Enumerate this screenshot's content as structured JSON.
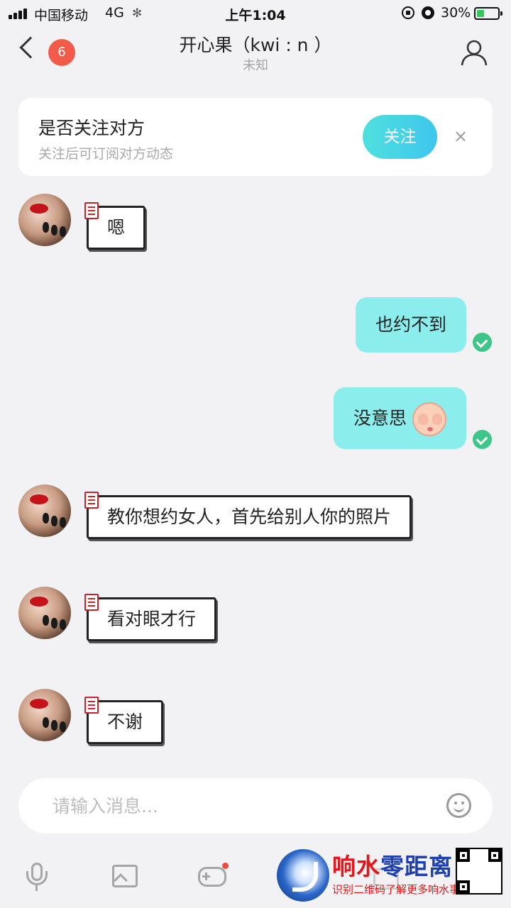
{
  "status_bar": {
    "carrier": "中国移动",
    "network": "4G",
    "time": "上午1:04",
    "battery_percent": "30%"
  },
  "header": {
    "unread_count": "6",
    "title": "开心果（kwi : n ）",
    "subtitle": "未知"
  },
  "follow_card": {
    "title": "是否关注对方",
    "description": "关注后可订阅对方动态",
    "button_label": "关注",
    "close_label": "×"
  },
  "messages": [
    {
      "direction": "incoming",
      "text": "嗯"
    },
    {
      "direction": "outgoing",
      "text": "也约不到",
      "read": true
    },
    {
      "direction": "outgoing",
      "text": "没意思",
      "emoji": "covering-eyes-face",
      "read": true
    },
    {
      "direction": "incoming",
      "text": "教你想约女人，首先给别人你的照片"
    },
    {
      "direction": "incoming",
      "text": "看对眼才行"
    },
    {
      "direction": "incoming",
      "text": "不谢"
    }
  ],
  "input": {
    "placeholder": "请输入消息..."
  },
  "toolbar": {
    "icons": [
      "mic-icon",
      "image-icon",
      "game-controller-icon",
      "gift-icon"
    ]
  },
  "watermark": {
    "title_part1": "响水",
    "title_part2": "零距离",
    "subtitle": "识别二维码了解更多响水事"
  },
  "colors": {
    "accent": "#3ec6ee",
    "outgoing_bubble": "#8ceded",
    "badge": "#f25a4a",
    "read_check": "#3ec68a"
  }
}
